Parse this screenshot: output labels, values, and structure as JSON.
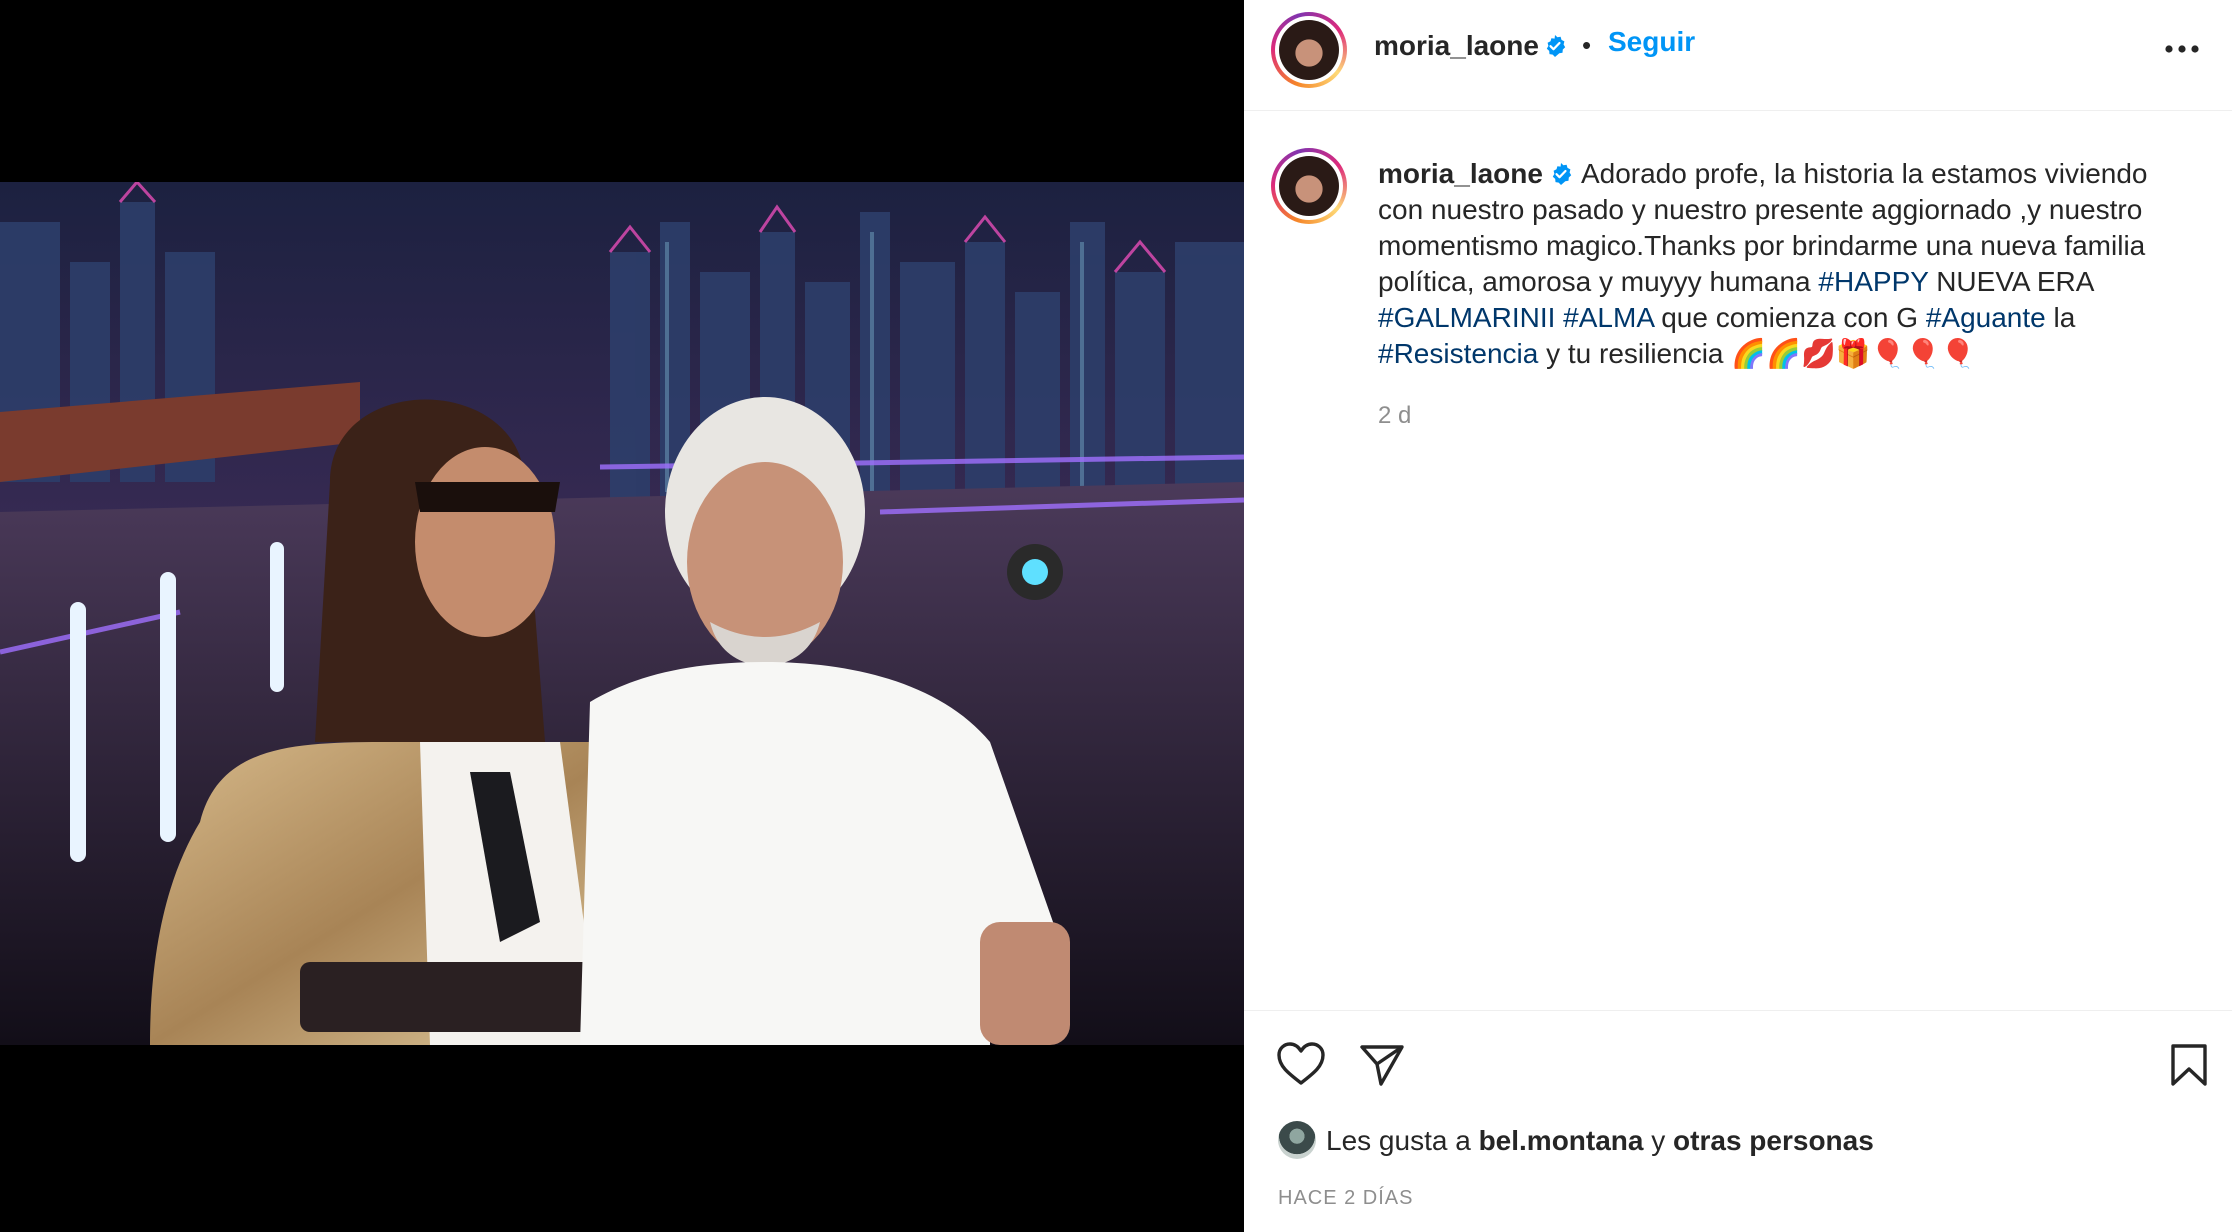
{
  "post": {
    "username": "moria_laone",
    "follow_label": "Seguir",
    "separator": "•",
    "caption": {
      "p1": "Adorado profe, la historia la estamos viviendo con nuestro pasado y nuestro presente aggiornado ,y nuestro momentismo magico.Thanks por brindarme una nueva familia política, amorosa y muyyy humana ",
      "tag_happy": "#HAPPY",
      "p2": " NUEVA ERA ",
      "tag_galmarinii": "#GALMARINII",
      "p3": " ",
      "tag_alma": "#ALMA",
      "p4": " que comienza con G ",
      "tag_aguante": "#Aguante",
      "p5": " la ",
      "tag_resistencia": "#Resistencia",
      "p6": " y tu resiliencia 🌈🌈💋🎁🎈🎈🎈"
    },
    "timestamp": "2 d",
    "likes": {
      "prefix": "Les gusta a ",
      "user": "bel.montana",
      "mid": " y ",
      "others": "otras personas"
    },
    "date": "HACE 2 DÍAS"
  },
  "icons": {
    "verified": "verified-badge-icon",
    "more": "more-options-icon",
    "like": "heart-icon",
    "share": "paper-plane-icon",
    "save": "bookmark-icon"
  },
  "colors": {
    "accent_blue": "#0095f6",
    "hashtag": "#00376b",
    "muted": "#8e8e8e"
  }
}
